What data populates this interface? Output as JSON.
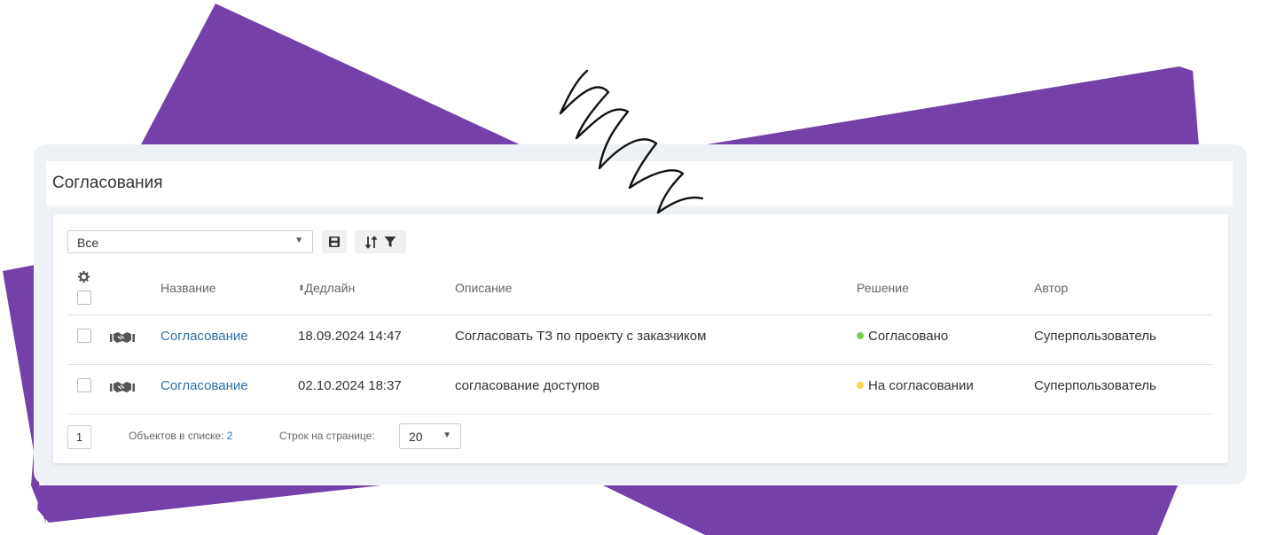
{
  "page": {
    "title": "Согласования"
  },
  "toolbar": {
    "filter_value": "Все",
    "icons": [
      "caret-down-icon",
      "save-icon",
      "sort-icon",
      "filter-icon"
    ]
  },
  "table": {
    "columns": {
      "name": "Название",
      "deadline": "Дедлайн",
      "description": "Описание",
      "decision": "Решение",
      "author": "Автор"
    },
    "rows": [
      {
        "name": "Согласование",
        "deadline": "18.09.2024 14:47",
        "description": "Согласовать ТЗ по проекту с заказчиком",
        "decision": "Согласовано",
        "decision_color": "#7ccd5a",
        "author": "Суперпользователь",
        "icon": "handshake-icon"
      },
      {
        "name": "Согласование",
        "deadline": "02.10.2024 18:37",
        "description": "согласование доступов",
        "decision": "На согласовании",
        "decision_color": "#f5d84a",
        "author": "Суперпользователь",
        "icon": "handshake-icon"
      }
    ]
  },
  "footer": {
    "page": "1",
    "objects_label": "Объектов в списке:",
    "objects_count": "2",
    "rows_label": "Строк на странице:",
    "rows_per_page": "20"
  },
  "colors": {
    "accent_purple": "#7441a8",
    "link": "#2f6fa7"
  }
}
